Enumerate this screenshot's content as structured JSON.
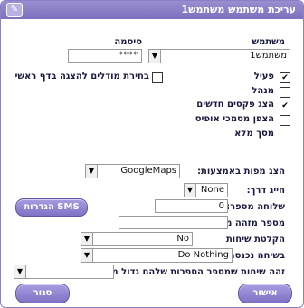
{
  "title": "עריכת משתמש משתמש1",
  "user": {
    "label": "משתמש",
    "value": "משתמש1"
  },
  "password": {
    "label": "סיסמה",
    "value": "****"
  },
  "checkboxes": {
    "active": {
      "label": "פעיל",
      "checked": true
    },
    "select_models": {
      "label": "בחירת מודלים להצגה בדף ראשי",
      "checked": false
    },
    "manager": {
      "label": "מנהל",
      "checked": false
    },
    "show_new_faxes": {
      "label": "הצג פקסים חדשים",
      "checked": true
    },
    "encrypt_emails": {
      "label": "הצפן מסמכי אופיס",
      "checked": false
    },
    "full_screen": {
      "label": "מסך מלא",
      "checked": false
    }
  },
  "show_maps": {
    "label": "הצג מפות באמצעות:",
    "value": "GoogleMaps"
  },
  "road_charge": {
    "label": "חייג דרך:",
    "value": "None"
  },
  "extension": {
    "label": "שלוחה מספר:",
    "value": "0"
  },
  "sms_button": "הגדרות SMS",
  "caller_id": {
    "label": "מספר מזהה מחייגים:",
    "value": ""
  },
  "record_calls": {
    "label": "הקלטת שיחות",
    "value": "No"
  },
  "on_incoming": {
    "label": "בשיחה נכנסת:",
    "value": "Do Nothing"
  },
  "identify_calls": {
    "label": "זהה שיחות שמספר הספרות שלהם גדול מ:",
    "value": ""
  },
  "ok_button": "אישור",
  "close_button": "סגור"
}
